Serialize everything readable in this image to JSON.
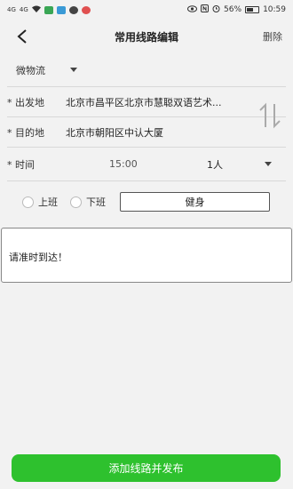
{
  "status_bar": {
    "signal1": "4G",
    "signal2": "4G",
    "battery_pct": "56%",
    "battery_level": 0.56,
    "time": "10:59"
  },
  "nav": {
    "title": "常用线路编辑",
    "delete_label": "删除"
  },
  "form": {
    "type_value": "微物流",
    "origin_label": "* 出发地",
    "origin_value": "北京市昌平区北京市慧聪双语艺术...",
    "destination_label": "* 目的地",
    "destination_value": "北京市朝阳区中认大厦",
    "time_label": "* 时间",
    "time_value": "15:00",
    "people_value": "1人"
  },
  "tags": {
    "option1": "上班",
    "option2": "下班",
    "custom_value": "健身"
  },
  "note": {
    "text": "请准时到达！"
  },
  "submit_label": "添加线路并发布",
  "colors": {
    "accent": "#2ec12e",
    "background": "#f2f2f2"
  }
}
